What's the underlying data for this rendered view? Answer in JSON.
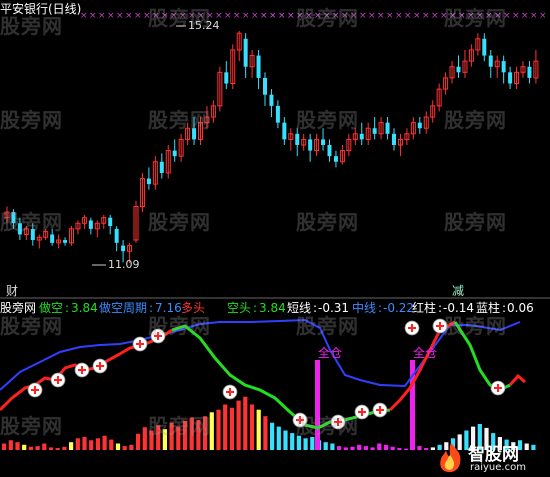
{
  "title": "平安银行(日线)",
  "colors": {
    "up": "#ff3333",
    "down": "#38e0ff",
    "red_line": "#ff2020",
    "blue_line": "#3040ff",
    "green_line": "#22dd22",
    "magenta": "#ee22ee",
    "bg": "#000000"
  },
  "price_panel": {
    "high_label": "15.24",
    "low_label": "11.09",
    "cai_marker": "财",
    "jian_marker": "减"
  },
  "indicator_header": {
    "panel_name": "股旁网",
    "item1_label": "做空",
    "item1_value": "3.84",
    "item2_label": "做空周期",
    "item2_value": "7.16",
    "item3_label": "多头",
    "item4_label": "空头",
    "item4_value": "3.84",
    "item5_label": "短线",
    "item5_value": "-0.31",
    "item6_label": "中线",
    "item6_value": "-0.22",
    "item7_label": "红柱",
    "item7_value": "-0.14",
    "item8_label": "蓝柱",
    "item8_value": "0.06"
  },
  "signals": {
    "quancang_1": "全仓",
    "quancang_2": "全仓"
  },
  "watermark": {
    "text": "股旁网"
  },
  "logo": {
    "name": "智股网",
    "url": "raiyue.com"
  },
  "chart_data": {
    "type": "candlestick",
    "price_candles": [
      [
        11.9,
        12.0,
        12.1,
        11.8
      ],
      [
        12.0,
        11.8,
        12.05,
        11.7
      ],
      [
        11.8,
        11.6,
        11.9,
        11.5
      ],
      [
        11.6,
        11.7,
        11.75,
        11.5
      ],
      [
        11.7,
        11.5,
        11.8,
        11.4
      ],
      [
        11.5,
        11.55,
        11.6,
        11.35
      ],
      [
        11.55,
        11.65,
        11.7,
        11.5
      ],
      [
        11.6,
        11.45,
        11.7,
        11.4
      ],
      [
        11.45,
        11.5,
        11.6,
        11.35
      ],
      [
        11.5,
        11.45,
        11.55,
        11.4
      ],
      [
        11.45,
        11.7,
        11.75,
        11.4
      ],
      [
        11.7,
        11.8,
        11.85,
        11.6
      ],
      [
        11.8,
        11.9,
        11.95,
        11.7
      ],
      [
        11.85,
        11.7,
        11.9,
        11.6
      ],
      [
        11.7,
        11.8,
        11.85,
        11.55
      ],
      [
        11.8,
        11.9,
        11.95,
        11.7
      ],
      [
        11.9,
        11.75,
        11.95,
        11.6
      ],
      [
        11.7,
        11.45,
        11.75,
        11.3
      ],
      [
        11.4,
        11.3,
        11.5,
        11.1
      ],
      [
        11.3,
        11.4,
        11.45,
        11.09
      ],
      [
        11.5,
        12.1,
        12.2,
        11.45
      ],
      [
        12.1,
        12.6,
        12.7,
        12.0
      ],
      [
        12.6,
        12.5,
        12.8,
        12.4
      ],
      [
        12.5,
        12.9,
        13.0,
        12.4
      ],
      [
        12.9,
        12.7,
        13.05,
        12.6
      ],
      [
        12.7,
        13.1,
        13.2,
        12.6
      ],
      [
        13.1,
        13.0,
        13.3,
        12.9
      ],
      [
        13.0,
        13.3,
        13.4,
        12.9
      ],
      [
        13.3,
        13.5,
        13.6,
        13.2
      ],
      [
        13.5,
        13.3,
        13.7,
        13.2
      ],
      [
        13.3,
        13.6,
        13.7,
        13.2
      ],
      [
        13.6,
        13.7,
        13.9,
        13.5
      ],
      [
        13.7,
        13.9,
        14.0,
        13.6
      ],
      [
        13.9,
        14.5,
        14.6,
        13.8
      ],
      [
        14.5,
        14.3,
        14.7,
        14.2
      ],
      [
        14.3,
        14.9,
        15.0,
        14.2
      ],
      [
        14.9,
        15.2,
        15.24,
        14.7
      ],
      [
        15.1,
        14.6,
        15.2,
        14.4
      ],
      [
        14.6,
        14.8,
        14.9,
        14.4
      ],
      [
        14.8,
        14.4,
        14.9,
        14.2
      ],
      [
        14.4,
        14.1,
        14.5,
        13.9
      ],
      [
        14.1,
        13.9,
        14.2,
        13.7
      ],
      [
        13.9,
        13.6,
        14.0,
        13.5
      ],
      [
        13.6,
        13.3,
        13.7,
        13.2
      ],
      [
        13.3,
        13.4,
        13.5,
        13.1
      ],
      [
        13.4,
        13.2,
        13.5,
        13.0
      ],
      [
        13.2,
        13.3,
        13.4,
        13.1
      ],
      [
        13.3,
        13.1,
        13.4,
        12.9
      ],
      [
        13.1,
        13.3,
        13.4,
        13.0
      ],
      [
        13.3,
        13.2,
        13.5,
        13.1
      ],
      [
        13.2,
        13.0,
        13.3,
        12.9
      ],
      [
        13.0,
        12.9,
        13.1,
        12.8
      ],
      [
        12.9,
        13.1,
        13.2,
        12.85
      ],
      [
        13.1,
        13.3,
        13.4,
        13.0
      ],
      [
        13.3,
        13.4,
        13.5,
        13.2
      ],
      [
        13.4,
        13.3,
        13.6,
        13.2
      ],
      [
        13.3,
        13.5,
        13.6,
        13.2
      ],
      [
        13.5,
        13.4,
        13.7,
        13.3
      ],
      [
        13.4,
        13.6,
        13.7,
        13.3
      ],
      [
        13.6,
        13.4,
        13.7,
        13.3
      ],
      [
        13.4,
        13.2,
        13.5,
        13.1
      ],
      [
        13.2,
        13.3,
        13.4,
        13.0
      ],
      [
        13.3,
        13.4,
        13.5,
        13.2
      ],
      [
        13.4,
        13.6,
        13.7,
        13.3
      ],
      [
        13.6,
        13.5,
        13.7,
        13.4
      ],
      [
        13.5,
        13.7,
        13.8,
        13.4
      ],
      [
        13.7,
        13.9,
        14.0,
        13.6
      ],
      [
        13.9,
        14.2,
        14.3,
        13.8
      ],
      [
        14.2,
        14.4,
        14.5,
        14.1
      ],
      [
        14.4,
        14.6,
        14.7,
        14.3
      ],
      [
        14.6,
        14.5,
        14.8,
        14.4
      ],
      [
        14.5,
        14.7,
        14.9,
        14.4
      ],
      [
        14.7,
        14.9,
        15.0,
        14.6
      ],
      [
        14.9,
        15.1,
        15.2,
        14.8
      ],
      [
        15.1,
        14.8,
        15.2,
        14.7
      ],
      [
        14.8,
        14.6,
        14.9,
        14.4
      ],
      [
        14.6,
        14.7,
        14.8,
        14.4
      ],
      [
        14.7,
        14.5,
        14.8,
        14.3
      ],
      [
        14.5,
        14.3,
        14.6,
        14.2
      ],
      [
        14.3,
        14.5,
        14.6,
        14.2
      ],
      [
        14.5,
        14.6,
        14.7,
        14.4
      ],
      [
        14.6,
        14.4,
        14.7,
        14.3
      ],
      [
        14.4,
        14.7,
        14.9,
        14.3
      ]
    ],
    "hist": [
      1,
      1.5,
      1.2,
      0.8,
      0.5,
      0.6,
      1.0,
      0.4,
      0.3,
      0.5,
      1.2,
      1.8,
      2.0,
      1.5,
      1.8,
      2.2,
      1.6,
      1.0,
      0.6,
      0.8,
      2.5,
      3.5,
      3.0,
      3.8,
      3.2,
      4.2,
      3.6,
      4.5,
      5.0,
      4.6,
      5.2,
      5.8,
      6.2,
      7.0,
      6.5,
      7.6,
      8.2,
      7.0,
      6.2,
      5.2,
      -4.2,
      -3.6,
      -3.0,
      -2.6,
      -2.2,
      -1.8,
      -2.0,
      -1.5,
      -1.2,
      -1.0,
      -0.6,
      -0.4,
      -0.5,
      -0.8,
      -0.6,
      -0.4,
      -1.0,
      -0.8,
      -0.5,
      -0.3,
      -0.2,
      -0.4,
      -0.6,
      -0.3,
      0.4,
      0.8,
      1.2,
      1.8,
      2.4,
      3.0,
      3.6,
      4.0,
      3.4,
      2.6,
      2.0,
      1.6,
      1.2,
      1.5,
      1.0,
      0.8
    ]
  }
}
